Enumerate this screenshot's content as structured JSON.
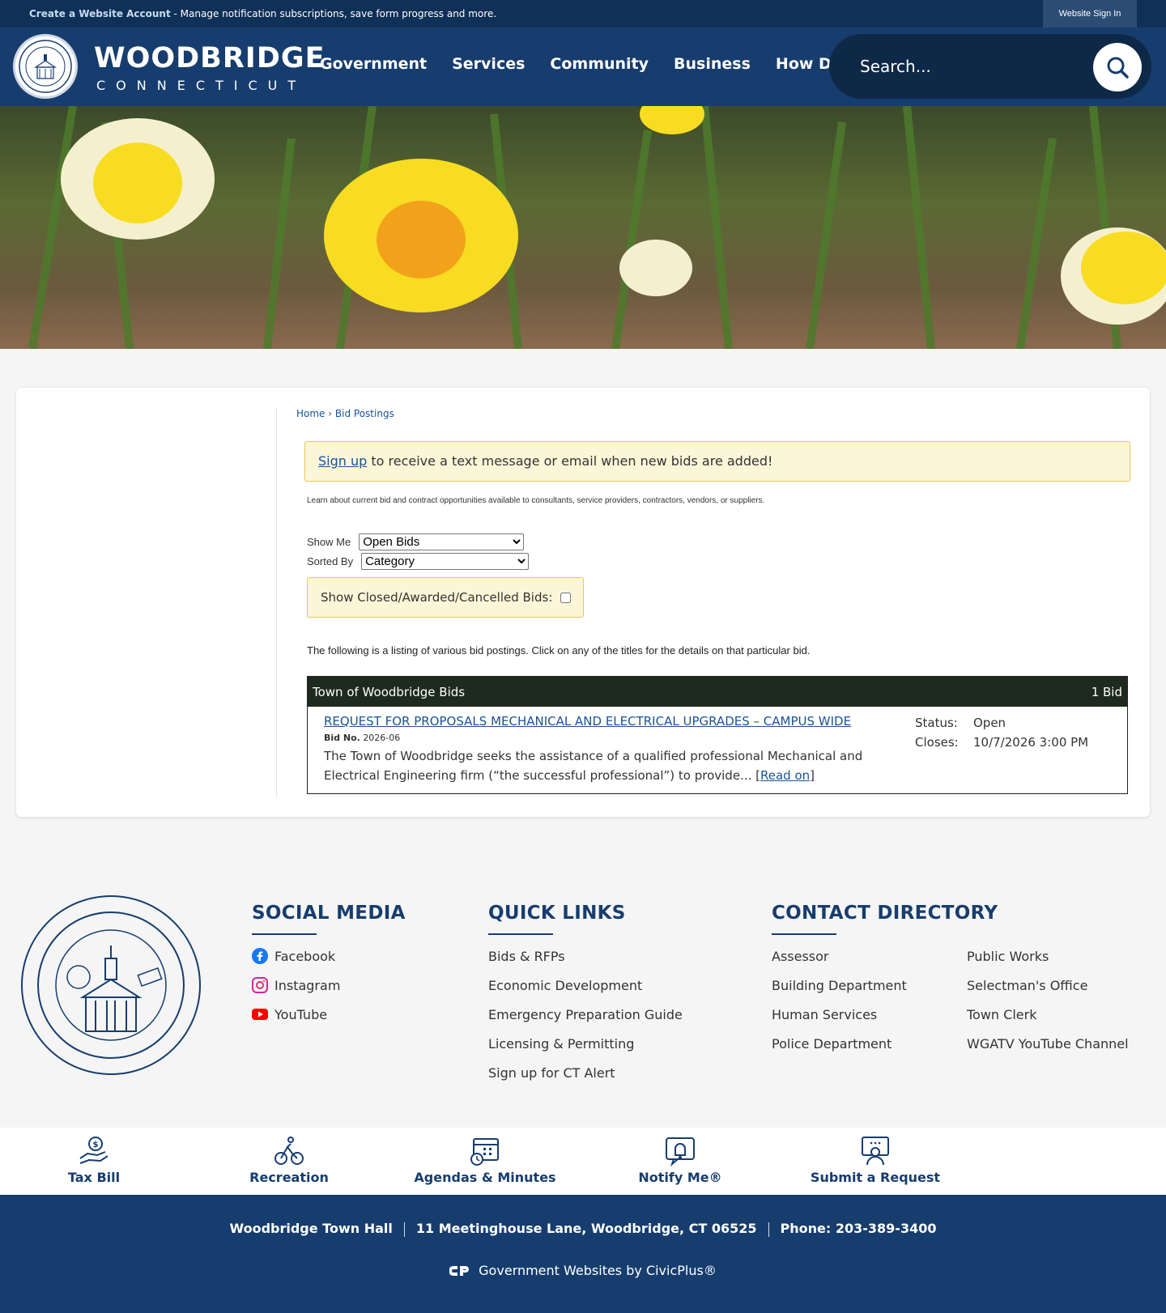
{
  "topbar": {
    "create_account": "Create a Website Account",
    "create_desc": " - Manage notification subscriptions, save form progress and more.",
    "sign_in": "Website Sign In"
  },
  "header": {
    "brand_name": "WOODBRIDGE",
    "brand_state": "CONNECTICUT",
    "nav": [
      "Government",
      "Services",
      "Community",
      "Business",
      "How Do I..."
    ],
    "search_placeholder": "Search..."
  },
  "breadcrumb": {
    "home": "Home",
    "sep": "›",
    "current": "Bid Postings"
  },
  "alert": {
    "link": "Sign up",
    "text": " to receive a text message or email when new bids are added!"
  },
  "intro": "Learn about current bid and contract opportunities available to consultants, service providers, contractors, vendors, or suppliers.",
  "filters": {
    "show_label": "Show Me",
    "show_value": "Open Bids",
    "sort_label": "Sorted By",
    "sort_value": "Category",
    "closed_label": "Show Closed/Awarded/Cancelled Bids:"
  },
  "listing_note": "The following is a listing of various bid postings. Click on any of the titles for the details on that particular bid.",
  "bids": {
    "category": "Town of Woodbridge Bids",
    "count": "1 Bid",
    "items": [
      {
        "title": "REQUEST FOR PROPOSALS MECHANICAL AND ELECTRICAL UPGRADES – CAMPUS WIDE",
        "bid_no_label": "Bid No.",
        "bid_no": "2026-06",
        "description": "The Town of Woodbridge seeks the assistance of a qualified professional Mechanical and Electrical Engineering firm (“the successful professional”) to provide...",
        "read_on": "Read on",
        "status_label": "Status:",
        "status": "Open",
        "closes_label": "Closes:",
        "closes": "10/7/2026 3:00 PM"
      }
    ]
  },
  "footer": {
    "social_title": "SOCIAL MEDIA",
    "social": [
      "Facebook",
      "Instagram",
      "YouTube"
    ],
    "quick_title": "QUICK LINKS",
    "quick": [
      "Bids & RFPs",
      "Economic Development",
      "Emergency Preparation Guide",
      "Licensing & Permitting",
      "Sign up for CT Alert"
    ],
    "contact_title": "CONTACT DIRECTORY",
    "contact_col1": [
      "Assessor",
      "Building Department",
      "Human Services",
      "Police Department"
    ],
    "contact_col2": [
      "Public Works",
      "Selectman's Office",
      "Town Clerk",
      "WGATV YouTube Channel"
    ]
  },
  "iconbar": [
    "Tax Bill",
    "Recreation",
    "Agendas & Minutes",
    "Notify Me®",
    "Submit a Request"
  ],
  "bottom": {
    "hall": "Woodbridge Town Hall",
    "address": "11 Meetinghouse Lane, Woodbridge, CT 06525",
    "phone": "Phone: 203-389-3400",
    "civic": "Government Websites by CivicPlus®"
  },
  "colors": {
    "navy": "#173d6e",
    "dark_navy": "#0f3057",
    "alert_bg": "#fbf6d7",
    "link": "#1a5296"
  }
}
